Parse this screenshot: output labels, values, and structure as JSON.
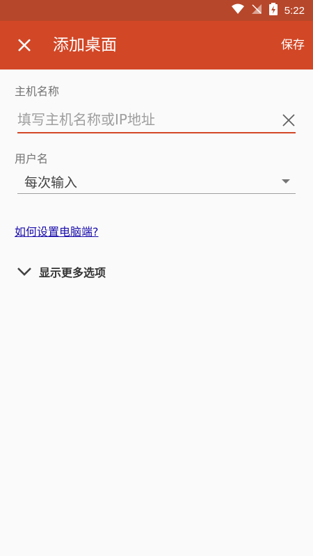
{
  "status_bar": {
    "time": "5:22",
    "icons": [
      "wifi-icon",
      "no-signal-icon",
      "battery-icon"
    ]
  },
  "app_bar": {
    "close_icon": "close-icon",
    "title": "添加桌面",
    "save_label": "保存"
  },
  "form": {
    "host": {
      "label": "主机名称",
      "placeholder": "填写主机名称或IP地址",
      "value": ""
    },
    "username": {
      "label": "用户名",
      "selected": "每次输入"
    },
    "help_link": "如何设置电脑端?",
    "more_options": "显示更多选项"
  },
  "colors": {
    "accent": "#d24726",
    "status_bar": "#b7472a",
    "link": "#1a0dab"
  }
}
